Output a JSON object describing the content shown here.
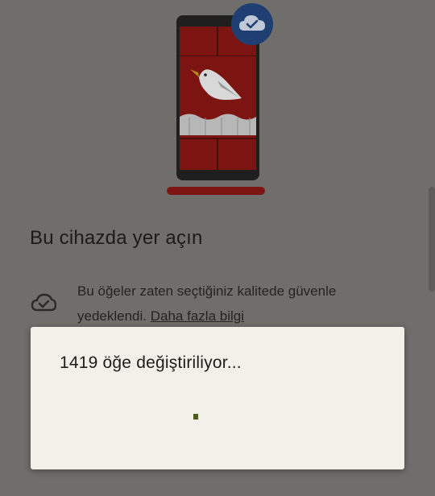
{
  "page": {
    "title": "Bu cihazda yer açın",
    "backup_text": "Bu öğeler zaten seçtiğiniz kalitede güvenle yedeklendi.",
    "learn_more": "Daha fazla bilgi"
  },
  "dialog": {
    "title": "1419 öğe değiştiriliyor..."
  },
  "icons": {
    "backup_done_badge": "cloud-done-icon",
    "backup_status": "cloud-check-icon"
  },
  "colors": {
    "scrim": "#6f6e6b",
    "dialog_bg": "#f1f0e9",
    "accent": "#4e5b1f",
    "phone_red": "#7c1511",
    "badge_blue": "#1f3f73"
  }
}
